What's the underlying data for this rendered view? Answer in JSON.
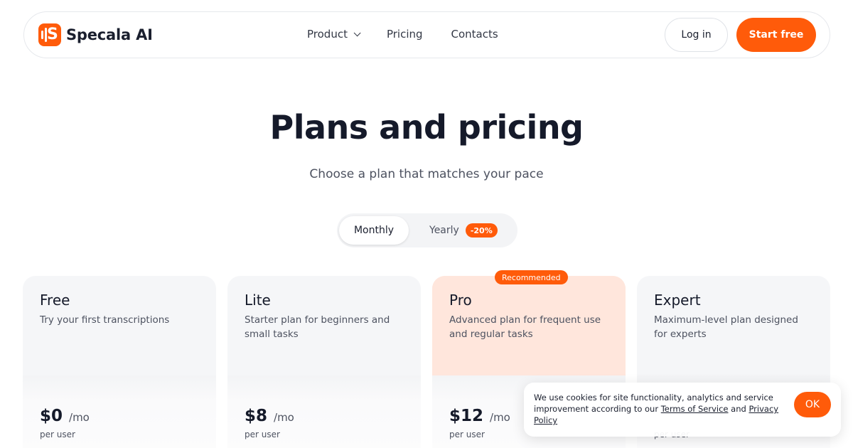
{
  "header": {
    "brand": "Specala AI",
    "nav": [
      {
        "label": "Product"
      },
      {
        "label": "Pricing"
      },
      {
        "label": "Contacts"
      }
    ],
    "login_label": "Log in",
    "start_label": "Start free",
    "accent": "#ff5b0a"
  },
  "hero": {
    "title": "Plans and pricing",
    "subtitle": "Choose a plan that matches your pace"
  },
  "billing_toggle": {
    "monthly": "Monthly",
    "yearly": "Yearly",
    "yearly_discount": "-20%",
    "selected": "Monthly"
  },
  "plans": [
    {
      "name": "Free",
      "desc": "Try your first transcriptions",
      "price": "$0",
      "period": "/mo",
      "per": "per user"
    },
    {
      "name": "Lite",
      "desc": "Starter plan for beginners and small tasks",
      "price": "$8",
      "period": "/mo",
      "per": "per user"
    },
    {
      "name": "Pro",
      "desc": "Advanced plan for frequent use and regular tasks",
      "price": "$12",
      "period": "/mo",
      "per": "per user",
      "badge": "Recommended"
    },
    {
      "name": "Expert",
      "desc": "Maximum-level plan designed for experts",
      "price": "",
      "period": "",
      "per": "per user"
    }
  ],
  "cookie": {
    "text_start": "We use cookies for site functionality, analytics and service improvement according to our ",
    "terms_link": "Terms of Service",
    "and": " and ",
    "privacy_link": "Privacy Policy",
    "ok_label": "OK"
  }
}
